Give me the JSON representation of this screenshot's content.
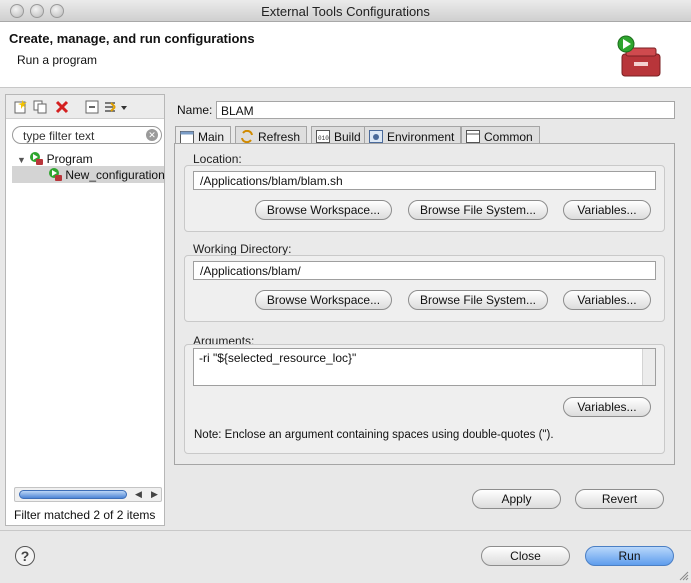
{
  "window": {
    "title": "External Tools Configurations"
  },
  "header": {
    "title": "Create, manage, and run configurations",
    "subtitle": "Run a program"
  },
  "left_panel": {
    "filter_placeholder": "type filter text",
    "tree": [
      {
        "label": "Program",
        "expanded": true,
        "icon": "program-icon"
      },
      {
        "label": "New_configuration",
        "selected": true,
        "icon": "config-icon"
      }
    ],
    "status": "Filter matched 2 of 2 items",
    "toolbar_icons": [
      "new-config-icon",
      "duplicate-icon",
      "delete-icon",
      "collapse-icon",
      "filter-icon"
    ]
  },
  "name": {
    "label": "Name:",
    "value": "BLAM"
  },
  "tabs": [
    {
      "label": "Main",
      "icon": "main-tab-icon",
      "active": true
    },
    {
      "label": "Refresh",
      "icon": "refresh-tab-icon"
    },
    {
      "label": "Build",
      "icon": "build-tab-icon"
    },
    {
      "label": "Environment",
      "icon": "environment-tab-icon"
    },
    {
      "label": "Common",
      "icon": "common-tab-icon"
    }
  ],
  "location": {
    "label": "Location:",
    "value": "/Applications/blam/blam.sh",
    "buttons": [
      "Browse Workspace...",
      "Browse File System...",
      "Variables..."
    ]
  },
  "working_directory": {
    "label": "Working Directory:",
    "value": "/Applications/blam/",
    "buttons": [
      "Browse Workspace...",
      "Browse File System...",
      "Variables..."
    ]
  },
  "arguments": {
    "label": "Arguments:",
    "value": "-ri \"${selected_resource_loc}\"",
    "variables_button": "Variables...",
    "note": "Note: Enclose an argument containing spaces using double-quotes (\")."
  },
  "actions": {
    "apply": "Apply",
    "revert": "Revert",
    "close": "Close",
    "run": "Run",
    "help": "?"
  },
  "colors": {
    "primary_button": "#5f9ded",
    "delete_icon": "#d42020",
    "run_icon": "#2fa52f",
    "toolbox": "#b8353a"
  }
}
